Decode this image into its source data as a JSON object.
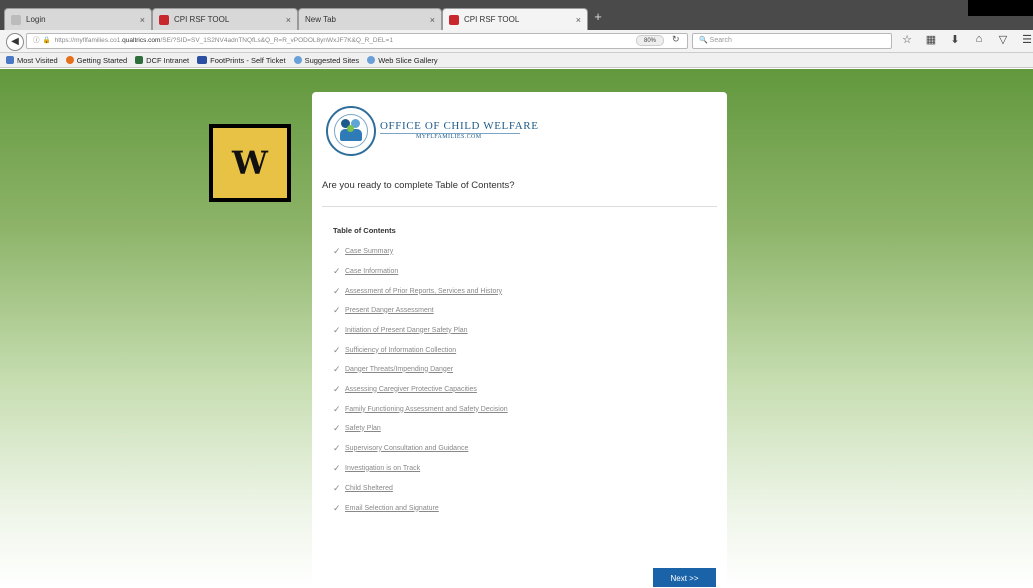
{
  "browser": {
    "tabs": [
      {
        "label": "Login",
        "icon": "generic-favicon",
        "active": false
      },
      {
        "label": "CPI RSF TOOL",
        "icon": "qualtrics-favicon",
        "active": false
      },
      {
        "label": "New Tab",
        "icon": "none",
        "active": false
      },
      {
        "label": "CPI RSF TOOL",
        "icon": "qualtrics-favicon",
        "active": true
      }
    ],
    "close_glyph": "×",
    "new_tab_glyph": "+",
    "url_prefix": "https://myflfamilies.co1.",
    "url_host": "qualtrics.com",
    "url_rest": "/SE/?SID=SV_1S2NV4adnTNQfLs&Q_R=R_vPODOL8ynWxJF7K&Q_R_DEL=1",
    "zoom": "80%",
    "search_placeholder": "Search"
  },
  "bookmarks": [
    {
      "label": "Most Visited",
      "color": "#4a78c4"
    },
    {
      "label": "Getting Started",
      "color": "#e5701c"
    },
    {
      "label": "DCF Intranet",
      "color": "#2f6e3a"
    },
    {
      "label": "FootPrints - Self Ticket",
      "color": "#2b4fa3"
    },
    {
      "label": "Suggested Sites",
      "color": "#6aa0d8"
    },
    {
      "label": "Web Slice Gallery",
      "color": "#6aa0d8"
    }
  ],
  "logo_letter": "W",
  "org": {
    "name": "OFFICE OF CHILD WELFARE",
    "site": "MYFLFAMILIES.COM"
  },
  "survey": {
    "question": "Are you ready to complete Table of Contents?",
    "toc_title": "Table of Contents",
    "items": [
      "Case Summary",
      "Case Information",
      "Assessment of Prior Reports, Services and History",
      "Present Danger Assessment",
      "Initiation of Present Danger Safety Plan",
      "Sufficiency of Information Collection",
      "Danger Threats/Impending Danger",
      "Assessing Caregiver Protective Capacities",
      "Family Functioning Assessment and Safety Decision",
      "Safety Plan",
      "Supervisory Consultation and Guidance",
      "Investigation is on Track",
      "Child Sheltered",
      "Email Selection and Signature"
    ],
    "next_label": "Next >>"
  },
  "colors": {
    "accent": "#1b63a8",
    "page_green": "#62983d",
    "logo_yellow": "#e8c244"
  }
}
